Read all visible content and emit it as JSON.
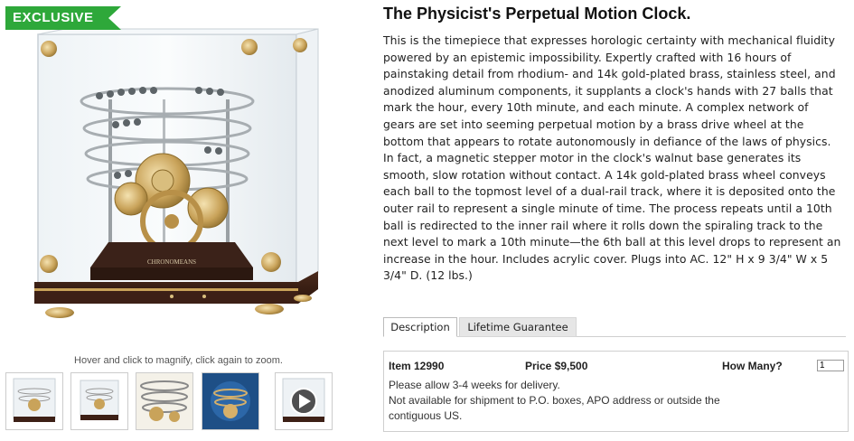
{
  "badge": {
    "label": "EXCLUSIVE",
    "color": "#2ea83a"
  },
  "gallery": {
    "hint": "Hover and click to magnify, click again to zoom.",
    "thumbnails": [
      "clock-front-thumbnail",
      "clock-angle-thumbnail",
      "clock-mechanism-thumbnail",
      "clock-blue-detail-thumbnail",
      "clock-video-thumbnail"
    ]
  },
  "product": {
    "title": "The Physicist's Perpetual Motion Clock.",
    "description": "This is the timepiece that expresses horologic certainty with mechanical fluidity powered by an epistemic impossibility. Expertly crafted with 16 hours of painstaking detail from rhodium- and 14k gold-plated brass, stainless steel, and anodized aluminum components, it supplants a clock's hands with 27 balls that mark the hour, every 10th minute, and each minute. A complex network of gears are set into seeming perpetual motion by a brass drive wheel at the bottom that appears to rotate autonomously in defiance of the laws of physics. In fact, a magnetic stepper motor in the clock's walnut base generates its smooth, slow rotation without contact. A 14k gold-plated brass wheel conveys each ball to the topmost level of a dual-rail track, where it is deposited onto the outer rail to represent a single minute of time. The process repeats until a 10th ball is redirected to the inner rail where it rolls down the spiraling track to the next level to mark a 10th minute—the 6th ball at this level drops to represent an increase in the hour. Includes acrylic cover. Plugs into AC. 12\" H x 9 3/4\" W x 5 3/4\" D. (12 lbs.)",
    "brand_plate": "CHRONOMEANS"
  },
  "tabs": [
    {
      "label": "Description",
      "active": true
    },
    {
      "label": "Lifetime Guarantee",
      "active": false
    }
  ],
  "order": {
    "item": "Item 12990",
    "price": "Price $9,500",
    "qty_label": "How Many?",
    "qty_value": "1",
    "notes": [
      "Please allow 3-4 weeks for delivery.",
      "Not available for shipment to P.O. boxes, APO address or outside the",
      "contiguous US."
    ]
  }
}
